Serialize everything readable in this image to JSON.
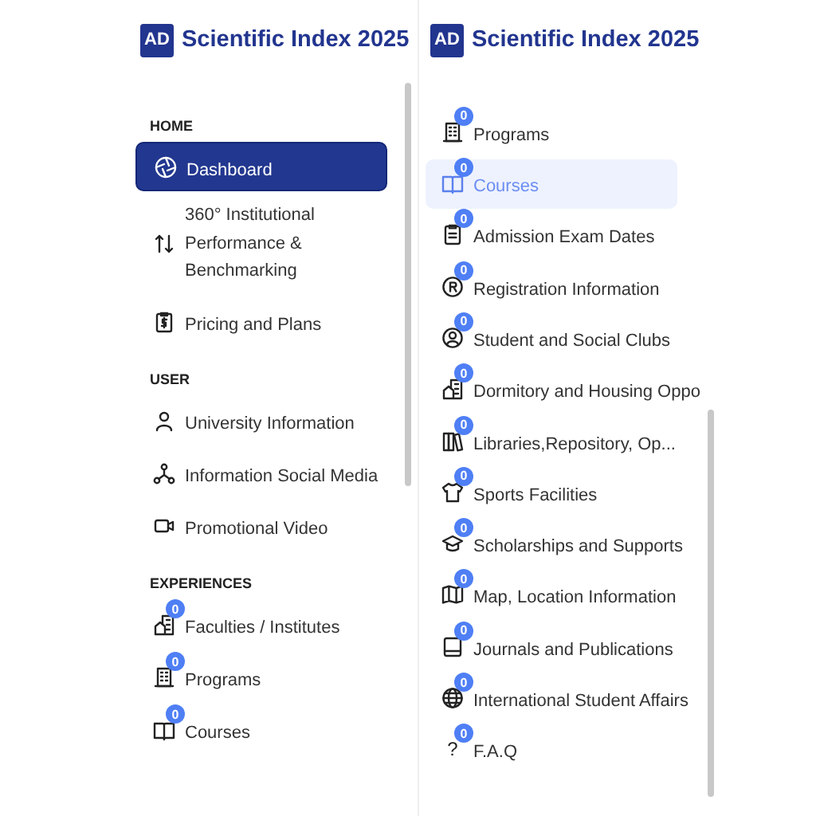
{
  "panels": [
    {
      "logo": "AD",
      "title": "Scientific Index 2025",
      "sections": [
        {
          "heading": "HOME",
          "items": [
            {
              "label": "Dashboard",
              "selected": true
            },
            {
              "label": "360° Institutional Performance & Benchmarking",
              "selected": false
            },
            {
              "label": "Pricing and Plans",
              "selected": false
            }
          ]
        },
        {
          "heading": "USER",
          "items": [
            {
              "label": "University Information",
              "selected": false
            },
            {
              "label": "Information Social Media",
              "selected": false
            },
            {
              "label": "Promotional Video",
              "selected": false
            }
          ]
        },
        {
          "heading": "EXPERIENCES",
          "items": [
            {
              "label": "Faculties / Institutes",
              "badge": "0",
              "selected": false
            },
            {
              "label": "Programs",
              "badge": "0",
              "selected": false
            },
            {
              "label": "Courses",
              "badge": "0",
              "selected": false
            }
          ]
        }
      ]
    },
    {
      "logo": "AD",
      "title": "Scientific Index 2025",
      "sections": [
        {
          "items": [
            {
              "label": "Programs",
              "badge": "0",
              "selected": false
            },
            {
              "label": "Courses",
              "badge": "0",
              "selected": true
            },
            {
              "label": "Admission Exam Dates",
              "badge": "0",
              "selected": false
            },
            {
              "label": "Registration Information",
              "badge": "0",
              "selected": false
            },
            {
              "label": "Student and Social Clubs",
              "badge": "0",
              "selected": false
            },
            {
              "label": "Dormitory and Housing Oppo",
              "badge": "0",
              "selected": false
            },
            {
              "label": "Libraries,Repository, Op...",
              "badge": "0",
              "selected": false
            },
            {
              "label": "Sports Facilities",
              "badge": "0",
              "selected": false
            },
            {
              "label": "Scholarships and Supports",
              "badge": "0",
              "selected": false
            },
            {
              "label": "Map, Location Information",
              "badge": "0",
              "selected": false
            },
            {
              "label": "Journals and Publications",
              "badge": "0",
              "selected": false
            },
            {
              "label": "International Student Affairs",
              "badge": "0",
              "selected": false
            },
            {
              "label": "F.A.Q",
              "badge": "0",
              "glyph": "?",
              "selected": false
            }
          ]
        }
      ]
    }
  ]
}
